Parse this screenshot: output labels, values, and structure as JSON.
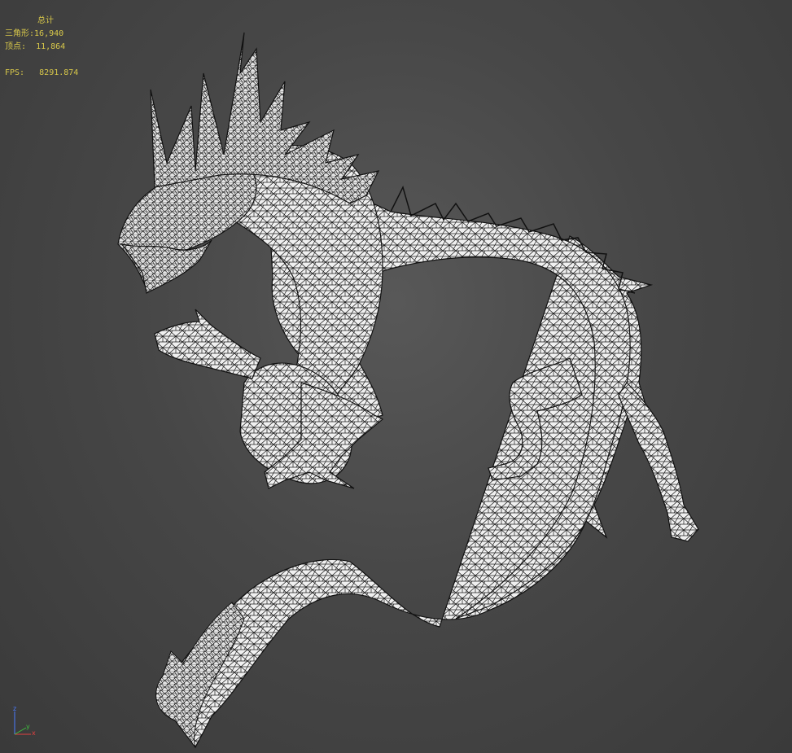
{
  "viewport": {
    "top_label": "",
    "stats": {
      "header": "总计",
      "triangles_label": "三角形:",
      "triangles_value": "16,940",
      "vertices_label": "顶点:",
      "vertices_value": "11,864",
      "fps_label": "FPS:",
      "fps_value": "8291.874"
    },
    "model": {
      "type": "wireframe-dragon",
      "fill": "#f2f2f2",
      "wire": "#111111"
    },
    "gizmo": {
      "x": "x",
      "y": "y",
      "z": "z",
      "x_color": "#e04040",
      "y_color": "#3fbf3f",
      "z_color": "#4a7bff"
    }
  }
}
